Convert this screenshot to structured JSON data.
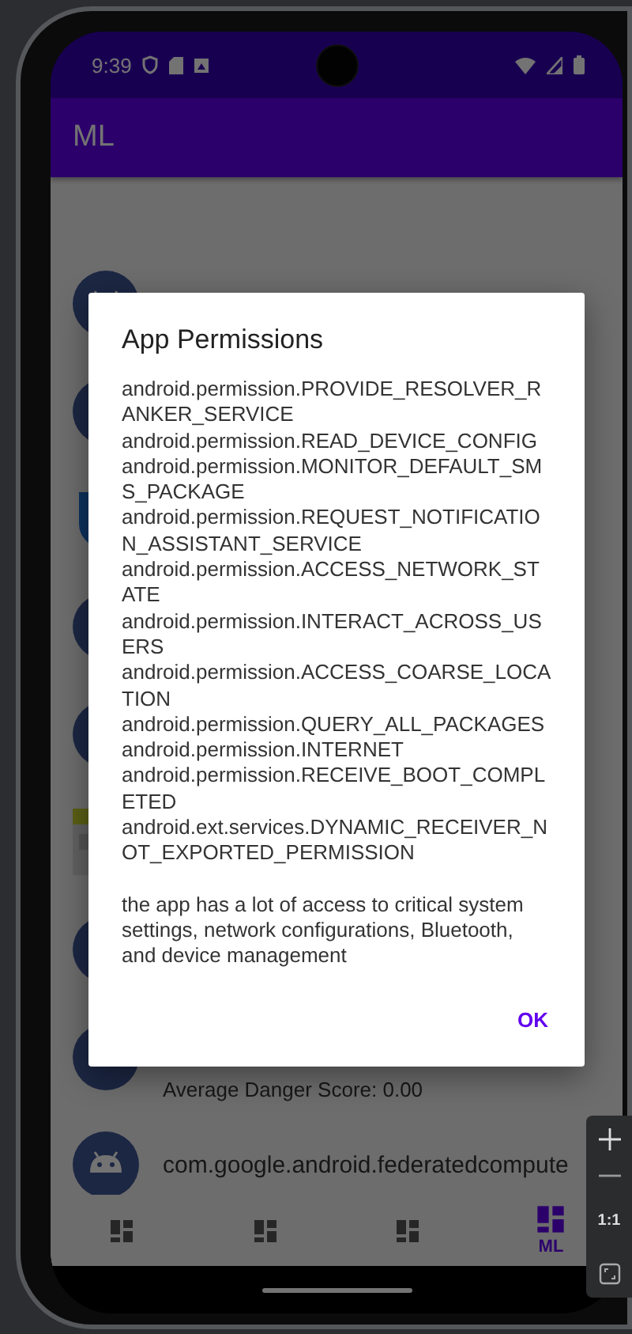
{
  "status_bar": {
    "time": "9:39"
  },
  "app_bar": {
    "title": "ML"
  },
  "apps": [
    {
      "kind": "avatar"
    },
    {
      "kind": "avatar"
    },
    {
      "kind": "shield"
    },
    {
      "kind": "avatar"
    },
    {
      "kind": "avatar"
    },
    {
      "kind": "tile"
    },
    {
      "kind": "avatar"
    },
    {
      "kind": "avatar",
      "subtitle": "Average Danger Score: 0.00"
    },
    {
      "kind": "avatar",
      "name": "com.google.android.federatedcompute"
    }
  ],
  "bottom_nav": [
    {
      "selected": false
    },
    {
      "selected": false
    },
    {
      "selected": false
    },
    {
      "label": "ML",
      "selected": true
    }
  ],
  "dialog": {
    "title": "App Permissions",
    "permissions": [
      "android.permission.PROVIDE_RESOLVER_RANKER_SERVICE",
      "android.permission.READ_DEVICE_CONFIG",
      "android.permission.MONITOR_DEFAULT_SMS_PACKAGE",
      "android.permission.REQUEST_NOTIFICATION_ASSISTANT_SERVICE",
      "android.permission.ACCESS_NETWORK_STATE",
      "android.permission.INTERACT_ACROSS_USERS",
      "android.permission.ACCESS_COARSE_LOCATION",
      "android.permission.QUERY_ALL_PACKAGES",
      "android.permission.INTERNET",
      "android.permission.RECEIVE_BOOT_COMPLETED",
      "android.ext.services.DYNAMIC_RECEIVER_NOT_EXPORTED_PERMISSION"
    ],
    "note": "the app has a lot of access to critical system settings, network configurations, Bluetooth, and device management",
    "button": "OK"
  },
  "emulator_toolbar": {
    "ratio_label": "1:1"
  }
}
